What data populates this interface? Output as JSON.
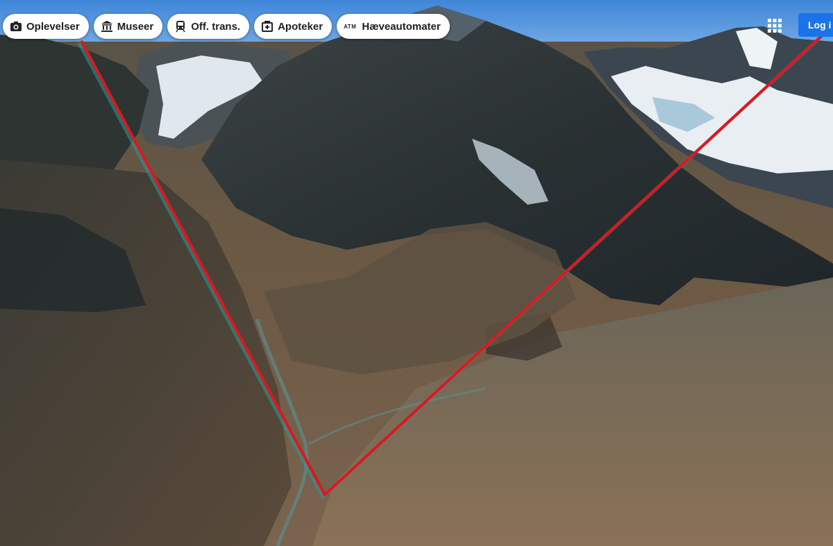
{
  "chips": [
    {
      "label": "Oplevelser",
      "icon": "camera-icon"
    },
    {
      "label": "Museer",
      "icon": "museum-icon"
    },
    {
      "label": "Off. trans.",
      "icon": "train-icon"
    },
    {
      "label": "Apoteker",
      "icon": "pharmacy-icon"
    },
    {
      "label": "Hæveautomater",
      "icon": "atm-icon",
      "icon_text": "ATM"
    }
  ],
  "header": {
    "apps_icon": "apps-grid-icon",
    "login_label": "Log i"
  },
  "overlay": {
    "annotation_color": "#e3141b",
    "shadow_color": "#1fa0a0"
  },
  "colors": {
    "login_button": "#1a73e8",
    "sky": "#4f8fd6"
  }
}
